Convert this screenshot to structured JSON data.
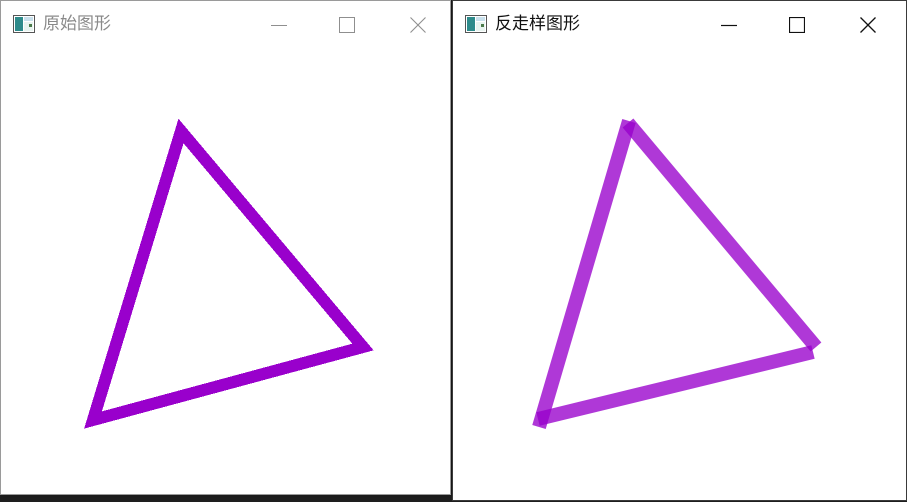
{
  "windows": {
    "left": {
      "title": "原始图形",
      "state": "inactive",
      "triangle": {
        "rendering": "aliased",
        "color": "#9900cc"
      }
    },
    "right": {
      "title": "反走样图形",
      "state": "active",
      "triangle": {
        "rendering": "antialiased",
        "color": "#9900cc",
        "opacity": 0.78
      }
    }
  },
  "icons": {
    "app": "window-app-icon",
    "minimize": "minimize-icon",
    "maximize": "maximize-icon",
    "close": "close-icon"
  },
  "colors": {
    "inactive_controls": "#8f8f8f",
    "active_controls": "#111111",
    "stroke": "#9900cc"
  }
}
